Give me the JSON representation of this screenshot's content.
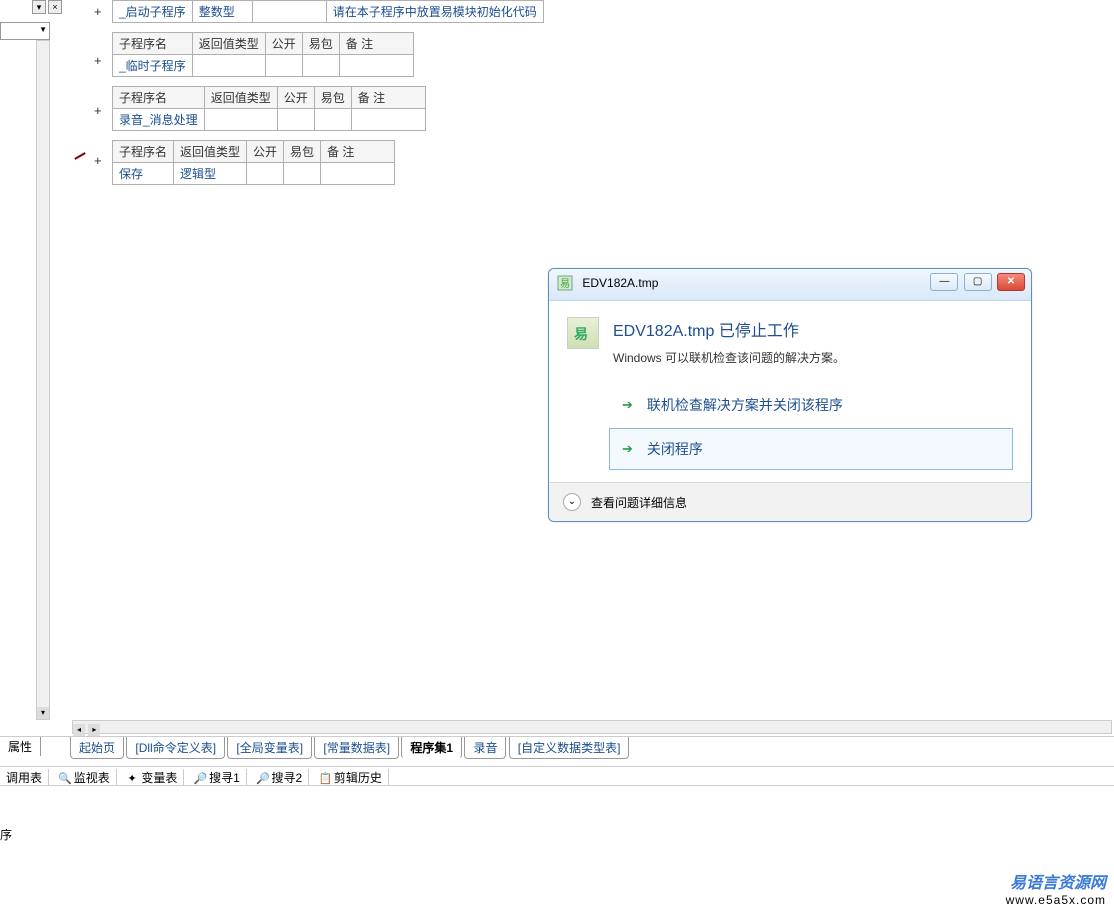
{
  "sidebar": {
    "prop_label": "属性"
  },
  "tables": {
    "headers": {
      "name": "子程序名",
      "type": "返回值类型",
      "pub": "公开",
      "pkg": "易包",
      "remark": "备 注"
    },
    "t1": {
      "name": "_启动子程序",
      "type": "整数型",
      "comment": "请在本子程序中放置易模块初始化代码"
    },
    "t2": {
      "name": "_临时子程序"
    },
    "t3": {
      "name": "录音_消息处理"
    },
    "t4": {
      "name": "保存",
      "type": "逻辑型"
    }
  },
  "tabs": {
    "start": "起始页",
    "dll": "[Dll命令定义表]",
    "global": "[全局变量表]",
    "const": "[常量数据表]",
    "prog1": "程序集1",
    "rec": "录音",
    "custom": "[自定义数据类型表]"
  },
  "toolbar": {
    "call": "调用表",
    "watch": "监视表",
    "var": "变量表",
    "search1": "搜寻1",
    "search2": "搜寻2",
    "clip": "剪辑历史"
  },
  "status": "序",
  "dialog": {
    "title": "EDV182A.tmp",
    "heading": "EDV182A.tmp 已停止工作",
    "sub": "Windows 可以联机检查该问题的解决方案。",
    "opt1": "联机检查解决方案并关闭该程序",
    "opt2": "关闭程序",
    "details": "查看问题详细信息"
  },
  "watermark": {
    "line1": "易语言资源网",
    "line2": "www.e5a5x.com"
  }
}
